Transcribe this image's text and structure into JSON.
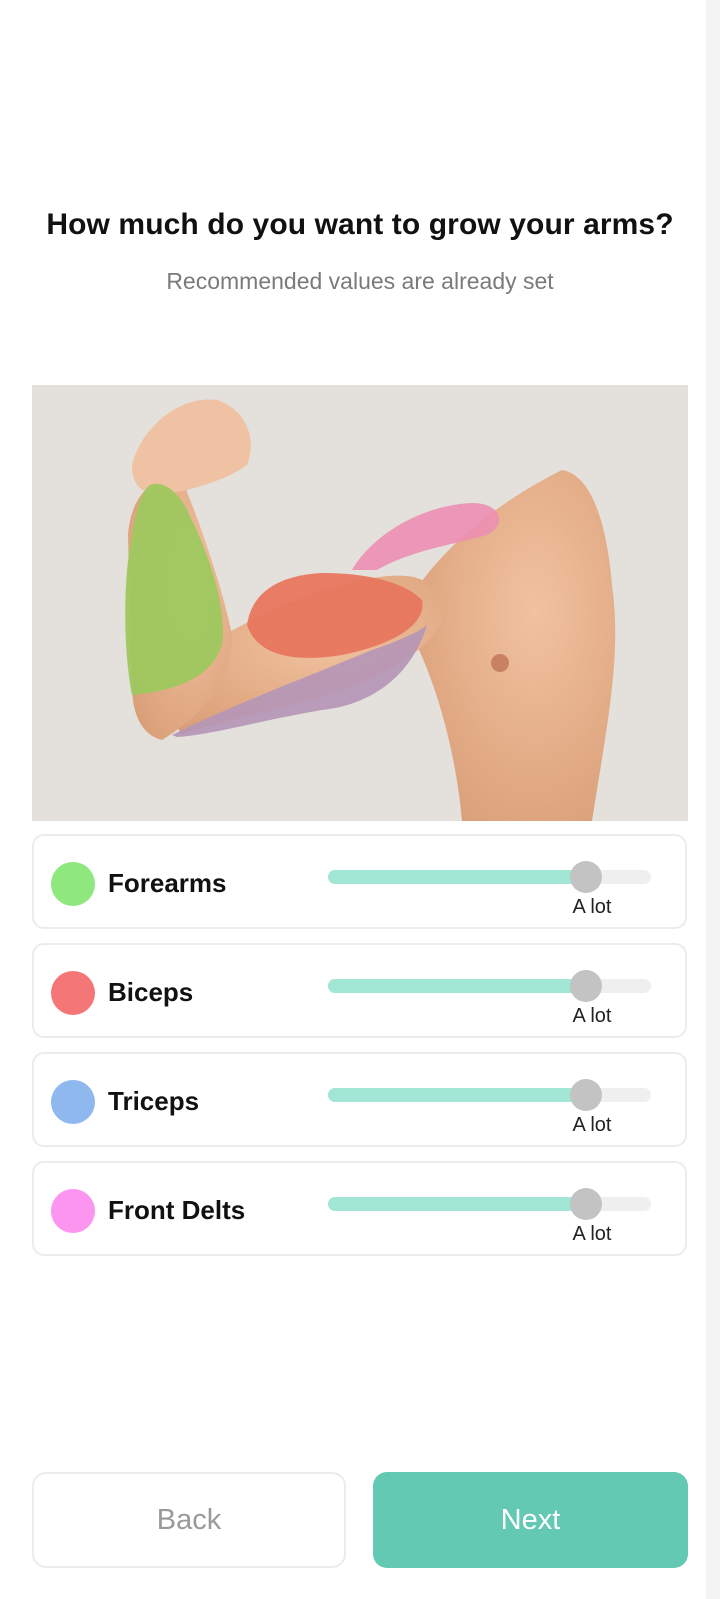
{
  "header": {
    "title": "How much do you want to grow your arms?",
    "subtitle": "Recommended values are already set"
  },
  "muscles": [
    {
      "label": "Forearms",
      "color": "#8ee87e",
      "value_label": "A lot",
      "level": 0.8
    },
    {
      "label": "Biceps",
      "color": "#f47676",
      "value_label": "A lot",
      "level": 0.8
    },
    {
      "label": "Triceps",
      "color": "#8eb8ee",
      "value_label": "A lot",
      "level": 0.8
    },
    {
      "label": "Front Delts",
      "color": "#fb95ef",
      "value_label": "A lot",
      "level": 0.8
    }
  ],
  "colors": {
    "accent": "#63c9b2",
    "slider_fill": "#a2e6d6",
    "slider_track": "#efefef",
    "thumb": "#c3c3c3"
  },
  "buttons": {
    "back_label": "Back",
    "next_label": "Next"
  }
}
